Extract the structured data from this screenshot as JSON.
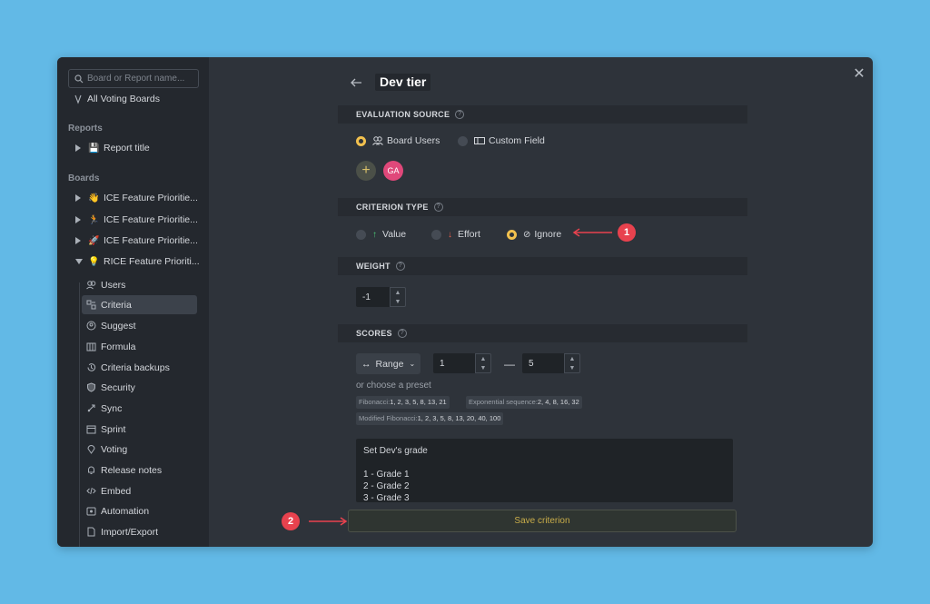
{
  "sidebar": {
    "search_placeholder": "Board or Report name...",
    "all_boards": "All Voting Boards",
    "reports_heading": "Reports",
    "report_item": {
      "emoji": "💾",
      "label": "Report title"
    },
    "boards_heading": "Boards",
    "boards": [
      {
        "emoji": "👋",
        "label": "ICE Feature Prioritie..."
      },
      {
        "emoji": "🏃",
        "label": "ICE Feature Prioritie..."
      },
      {
        "emoji": "🚀",
        "label": "ICE Feature Prioritie..."
      },
      {
        "emoji": "💡",
        "label": "RICE Feature Prioriti..."
      }
    ],
    "sub_items": [
      "Users",
      "Criteria",
      "Suggest",
      "Formula",
      "Criteria backups",
      "Security",
      "Sync",
      "Sprint",
      "Voting",
      "Release notes",
      "Embed",
      "Automation",
      "Import/Export"
    ]
  },
  "page": {
    "title": "Dev tier"
  },
  "evaluation_source": {
    "heading": "EVALUATION SOURCE",
    "options": [
      "Board Users",
      "Custom Field"
    ],
    "avatar_initials": "GA"
  },
  "criterion_type": {
    "heading": "CRITERION TYPE",
    "options": [
      "Value",
      "Effort",
      "Ignore"
    ]
  },
  "weight": {
    "heading": "WEIGHT",
    "value": "-1"
  },
  "scores": {
    "heading": "SCORES",
    "mode": "Range",
    "min": "1",
    "max": "5",
    "dash": "—",
    "preset_label": "or choose a preset",
    "presets": [
      {
        "label": "Fibonacci:",
        "values": "1, 2, 3, 5, 8, 13, 21"
      },
      {
        "label": "Exponential sequence:",
        "values": "2, 4, 8, 16, 32"
      },
      {
        "label": "Modified Fibonacci:",
        "values": "1, 2, 3, 5, 8, 13, 20, 40, 100"
      }
    ],
    "description_lines": [
      "Set Dev's grade",
      "",
      "1 - Grade 1",
      "2 - Grade 2",
      "3 - Grade 3"
    ]
  },
  "save_label": "Save criterion",
  "callouts": [
    "1",
    "2"
  ],
  "colors": {
    "background": "#62b9e6",
    "accent": "#f2c14e",
    "value_arrow": "#4cc777",
    "effort_arrow": "#e8604c",
    "callout": "#e8424e"
  }
}
